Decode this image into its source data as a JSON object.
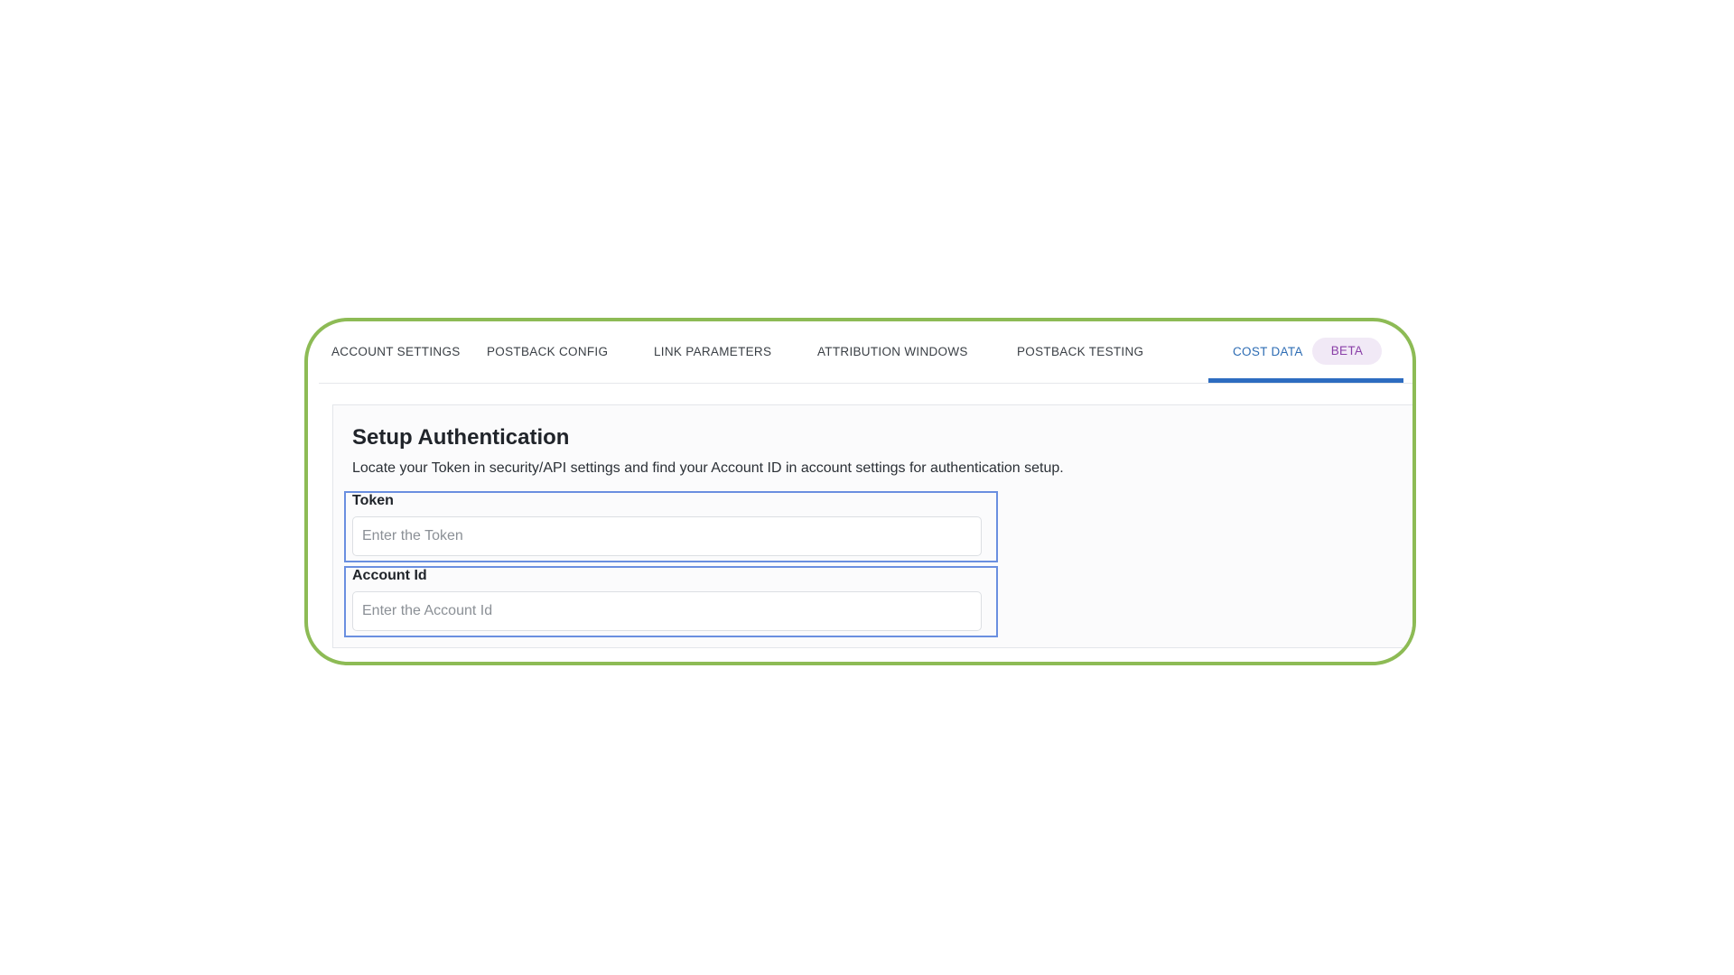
{
  "tabs": [
    {
      "label": "ACCOUNT SETTINGS"
    },
    {
      "label": "POSTBACK CONFIG"
    },
    {
      "label": "LINK PARAMETERS"
    },
    {
      "label": "ATTRIBUTION WINDOWS"
    },
    {
      "label": "POSTBACK TESTING"
    },
    {
      "label": "COST DATA",
      "badge": "BETA"
    }
  ],
  "active_tab": "COST DATA",
  "section": {
    "title": "Setup Authentication",
    "description": "Locate your Token in security/API settings and find your Account ID in account settings for authentication setup."
  },
  "fields": {
    "token": {
      "label": "Token",
      "placeholder": "Enter the Token",
      "value": ""
    },
    "account_id": {
      "label": "Account Id",
      "placeholder": "Enter the Account Id",
      "value": ""
    }
  },
  "colors": {
    "frame_border": "#8dbb55",
    "active_tab": "#2e6db4",
    "highlight_box": "#6a8fe0",
    "beta_badge_bg": "#f1e9f6",
    "beta_badge_text": "#8a3fa8"
  }
}
